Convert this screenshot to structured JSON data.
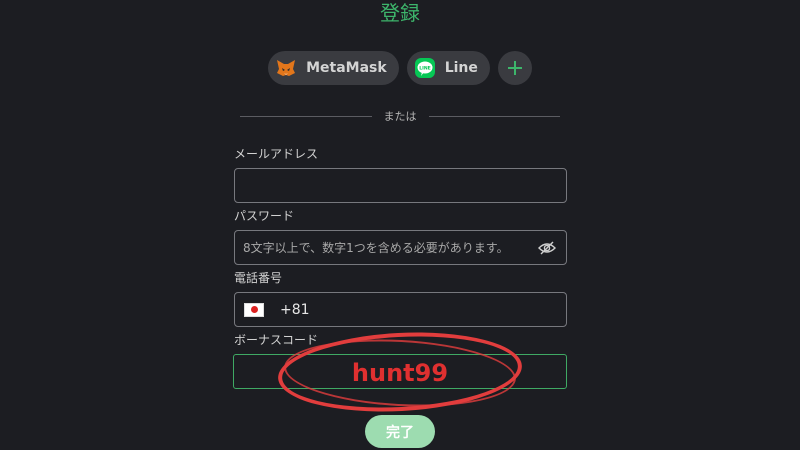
{
  "page": {
    "title": "登録"
  },
  "social": {
    "metamask_label": "MetaMask",
    "line_label": "Line",
    "line_logo_text": "LINE",
    "more_icon": "plus-icon"
  },
  "divider": {
    "text": "または"
  },
  "form": {
    "email": {
      "label": "メールアドレス",
      "value": "",
      "placeholder": ""
    },
    "password": {
      "label": "パスワード",
      "placeholder": "8文字以上で、数字1つを含める必要があります。",
      "icon": "eye-icon"
    },
    "phone": {
      "label": "電話番号",
      "country_code": "+81",
      "flag_icon": "japan-flag-icon"
    },
    "bonus": {
      "label": "ボーナスコード",
      "annotation": "hunt99"
    },
    "submit_label": "完了"
  },
  "colors": {
    "background": "#1c1d22",
    "accent_green": "#3db56b",
    "submit_button": "#9ddcb0",
    "annotation_red": "#e23d3d"
  }
}
